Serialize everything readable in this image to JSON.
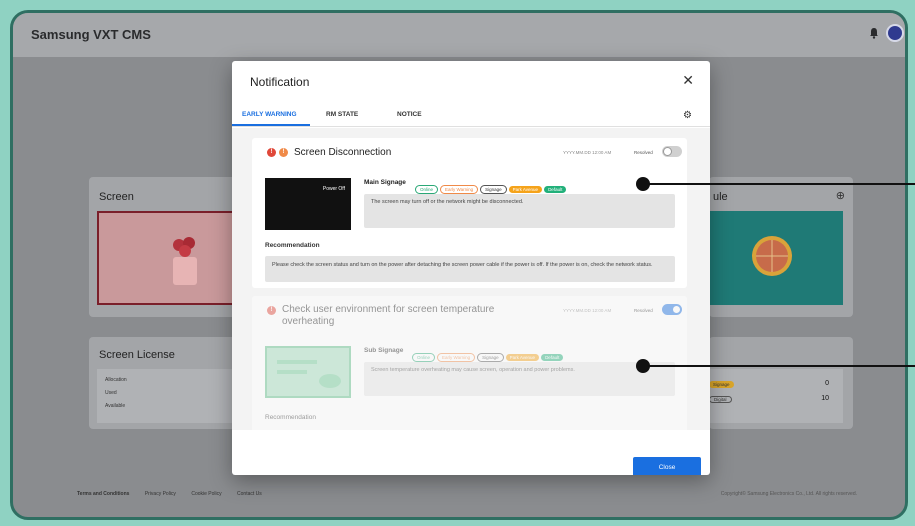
{
  "app": {
    "title": "Samsung VXT CMS"
  },
  "background": {
    "screen_card": {
      "title": "Screen"
    },
    "schedule_card": {
      "title": "ule"
    },
    "license_card": {
      "title": "Screen License",
      "rows": [
        {
          "label": "Allocation",
          "badge": "",
          "value": ""
        },
        {
          "label": "Used",
          "badge": "Signage",
          "value": "0"
        },
        {
          "label": "Available",
          "badge": "Digital",
          "value": "10"
        }
      ]
    },
    "footer": {
      "links": [
        "Terms and Conditions",
        "Privacy Policy",
        "Cookie Policy",
        "Contact Us"
      ],
      "copyright": "Copyright© Samsung Electronics Co., Ltd. All rights reserved."
    }
  },
  "modal": {
    "title": "Notification",
    "tabs": [
      {
        "label": "EARLY WARNING",
        "active": true
      },
      {
        "label": "RM STATE",
        "active": false
      },
      {
        "label": "NOTICE",
        "active": false
      }
    ],
    "close_label": "Close",
    "items": [
      {
        "title": "Screen Disconnection",
        "datetime": "YYYY.MM.DD 12:00 AM",
        "status_label": "Resolved",
        "resolved": false,
        "thumbnail_text": "Power Off",
        "signage_label": "Main Signage",
        "tags": [
          "Online",
          "Early Warning",
          "Signage",
          "Park Avenue",
          "Default"
        ],
        "message": "The screen may turn off or the network might be disconnected.",
        "recommendation_label": "Recommendation",
        "recommendation": "Please check the screen status and turn on the power after detaching the screen power cable if the power is off. If the power is on, check the network status."
      },
      {
        "title": "Check user environment for screen temperature overheating",
        "datetime": "YYYY.MM.DD 12:00 AM",
        "status_label": "Resolved",
        "resolved": true,
        "signage_label": "Sub Signage",
        "tags": [
          "Online",
          "Early Warning",
          "Signage",
          "Park Avenue",
          "Default"
        ],
        "message": "Screen temperature overheating may cause screen, operation and power problems.",
        "recommendation_label": "Recommendation"
      }
    ]
  },
  "colors": {
    "accent": "#1a6fe0",
    "danger": "#e0483a",
    "tag_online": "#2aa876",
    "tag_warning": "#f08a48",
    "tag_park": "#f5a31a",
    "tag_default": "#22b07a"
  }
}
